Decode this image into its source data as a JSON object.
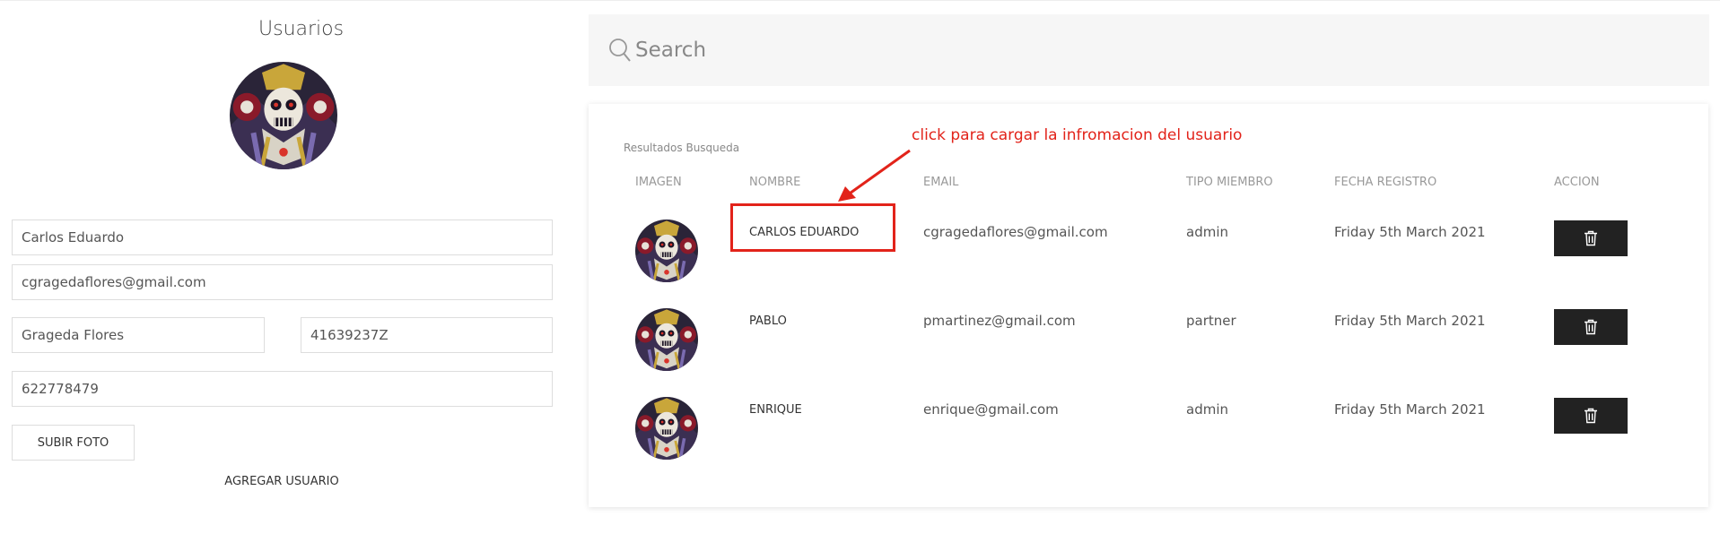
{
  "panel": {
    "title": "Usuarios",
    "form": {
      "nombre": "Carlos Eduardo",
      "email": "cgragedaflores@gmail.com",
      "apellidos": "Grageda Flores",
      "dni": "41639237Z",
      "telefono": "622778479"
    },
    "upload_label": "SUBIR FOTO",
    "add_label": "AGREGAR USUARIO"
  },
  "search": {
    "placeholder": "Search"
  },
  "results": {
    "label": "Resultados Busqueda",
    "columns": [
      "IMAGEN",
      "NOMBRE",
      "EMAIL",
      "TIPO MIEMBRO",
      "FECHA REGISTRO",
      "ACCION"
    ],
    "rows": [
      {
        "nombre": "CARLOS EDUARDO",
        "email": "cgragedaflores@gmail.com",
        "tipo": "admin",
        "fecha": "Friday 5th March 2021"
      },
      {
        "nombre": "PABLO",
        "email": "pmartinez@gmail.com",
        "tipo": "partner",
        "fecha": "Friday 5th March 2021"
      },
      {
        "nombre": "ENRIQUE",
        "email": "enrique@gmail.com",
        "tipo": "admin",
        "fecha": "Friday 5th March 2021"
      }
    ]
  },
  "annotation": {
    "text": "click para cargar la infromacion del usuario",
    "color": "#e2231a"
  },
  "colors": {
    "delete_button": "#222222",
    "search_bg": "#f6f6f6"
  },
  "icons": {
    "search": "search-icon",
    "delete": "trash-icon",
    "avatar": "skull-avatar"
  }
}
